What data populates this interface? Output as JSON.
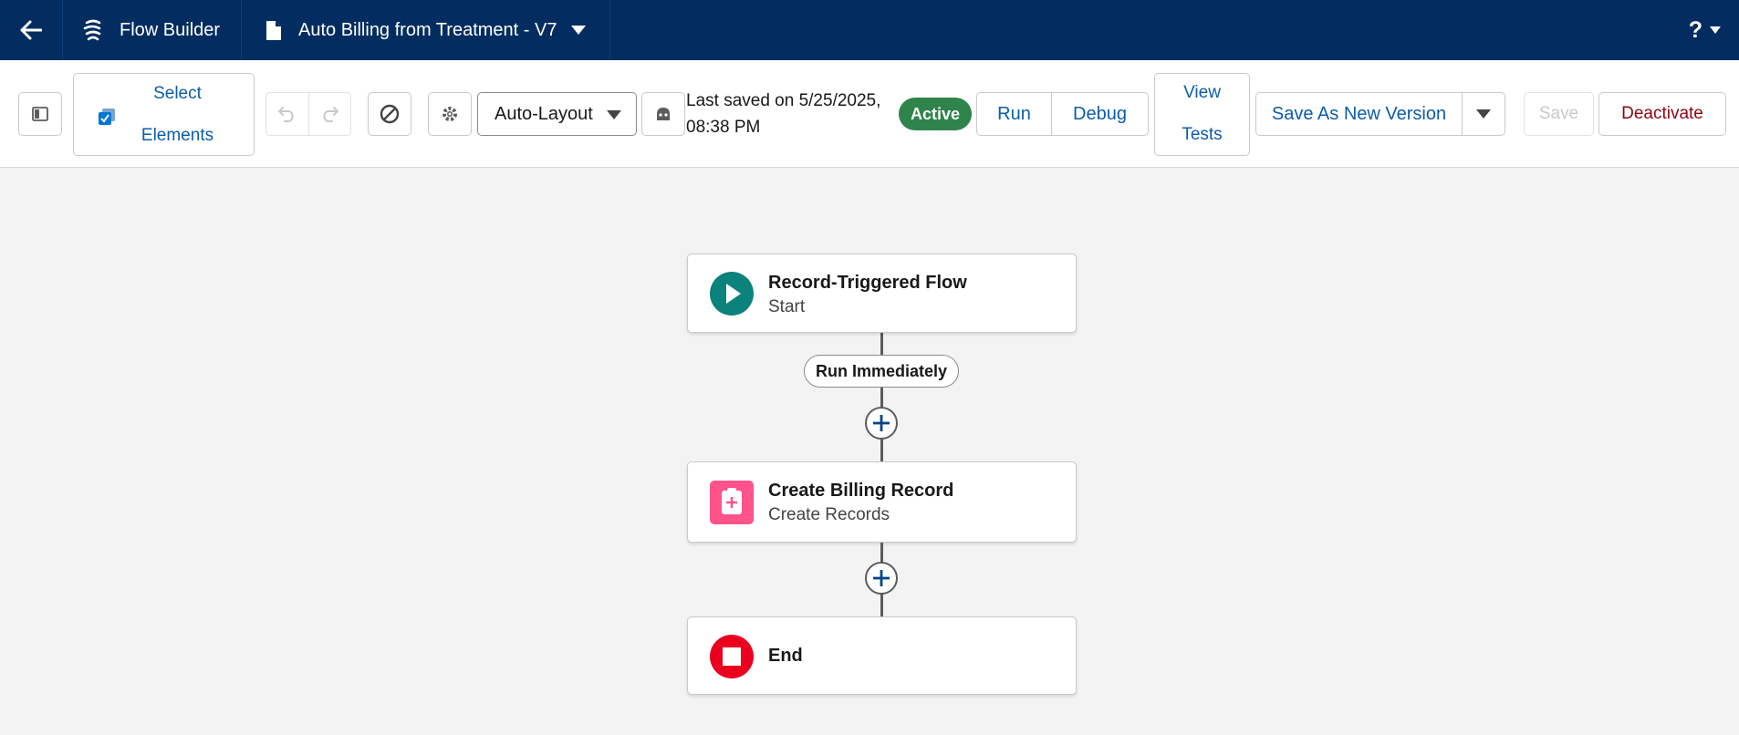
{
  "header": {
    "app_name": "Flow Builder",
    "flow_name": "Auto Billing from Treatment - V7",
    "help_label": "?"
  },
  "toolbar": {
    "select_elements_line1": "Select",
    "select_elements_line2": "Elements",
    "layout_value": "Auto-Layout",
    "saved_line1": "Last saved on 5/25/2025,",
    "saved_line2": "08:38 PM",
    "status_badge": "Active",
    "run_label": "Run",
    "debug_label": "Debug",
    "view_tests_line1": "View",
    "view_tests_line2": "Tests",
    "save_new_version_label": "Save As New Version",
    "save_label": "Save",
    "deactivate_label": "Deactivate"
  },
  "canvas": {
    "start_node": {
      "title": "Record-Triggered Flow",
      "subtitle": "Start"
    },
    "path_label": "Run Immediately",
    "create_node": {
      "title": "Create Billing Record",
      "subtitle": "Create Records"
    },
    "end_node": {
      "title": "End"
    }
  },
  "colors": {
    "header_bg": "#032d60",
    "brand_blue": "#0b5cab",
    "active_green": "#2e844a",
    "start_teal": "#0b827c",
    "create_pink": "#ff538a",
    "end_red": "#ea001e",
    "deactivate_red": "#8e030f"
  },
  "icons": {
    "back": "back-arrow-icon",
    "app": "flow-icon",
    "file": "file-icon",
    "start": "play-icon",
    "create": "clipboard-plus-icon",
    "end": "stop-icon"
  }
}
